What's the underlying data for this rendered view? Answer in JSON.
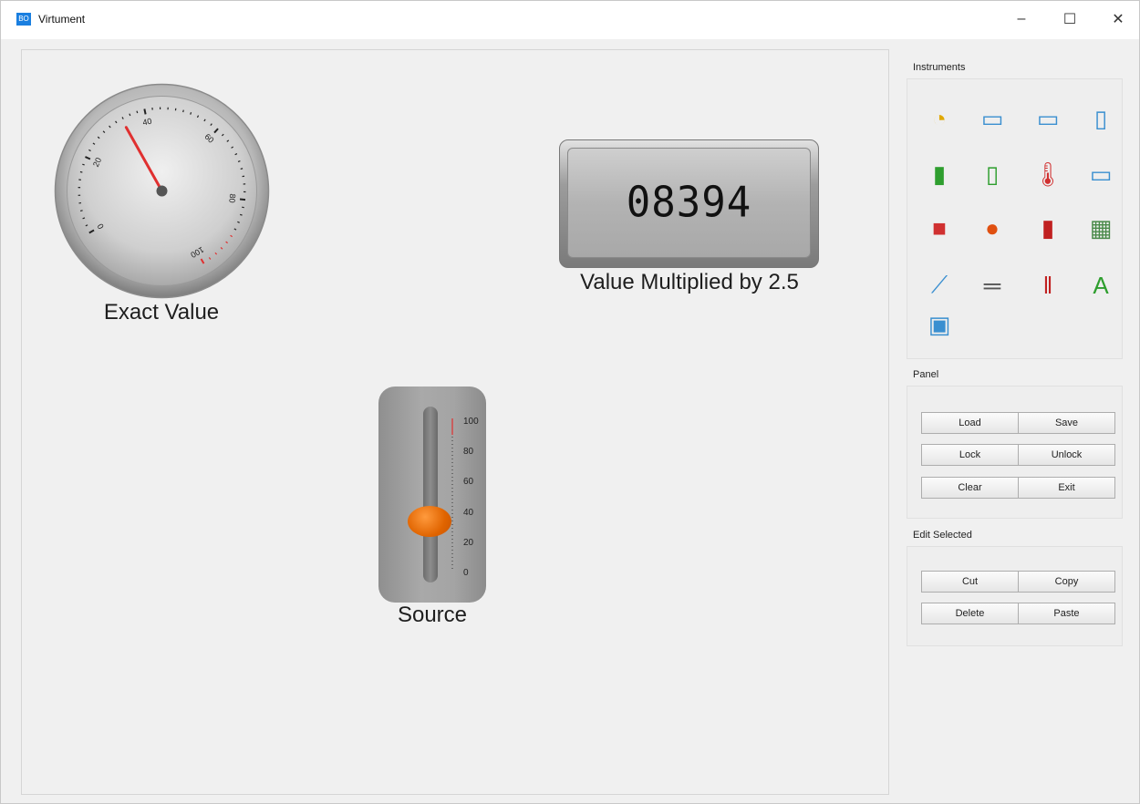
{
  "window": {
    "title": "Virtument",
    "app_icon_text": "BO",
    "controls": {
      "minimize": "–",
      "maximize": "☐",
      "close": "✕"
    }
  },
  "gauge": {
    "label": "Exact Value",
    "value": 33.6,
    "range": [
      0,
      100
    ],
    "ticks": [
      "0",
      "20",
      "40",
      "60",
      "80",
      "100"
    ],
    "needle_color": "#e03030"
  },
  "display": {
    "value": "08394",
    "label": "Value Multiplied by 2.5"
  },
  "slider": {
    "label": "Source",
    "value": 33.6,
    "range": [
      0,
      100
    ],
    "ticks": [
      "100",
      "80",
      "60",
      "40",
      "20",
      "0"
    ],
    "knob_color": "#e56a00"
  },
  "instruments": {
    "title": "Instruments",
    "items": [
      "analog-gauge-icon",
      "meter-icon",
      "linear-scale-icon",
      "vertical-scale-icon",
      "bar-graph-icon",
      "level-indicator-icon",
      "thermometer-icon",
      "digital-display-icon",
      "button-icon",
      "led-icon",
      "toggle-switch-icon",
      "image-icon",
      "chart-icon",
      "horizontal-slider-icon",
      "vertical-slider-icon",
      "text-label-icon",
      "frame-icon"
    ]
  },
  "panel": {
    "title": "Panel",
    "buttons": [
      "Load",
      "Save",
      "Lock",
      "Unlock",
      "Clear",
      "Exit"
    ]
  },
  "edit": {
    "title": "Edit Selected",
    "buttons": [
      "Cut",
      "Copy",
      "Delete",
      "Paste"
    ]
  },
  "colors": {
    "accent": "#1a7fe0",
    "knob": "#e56a00",
    "needle": "#e03030"
  }
}
